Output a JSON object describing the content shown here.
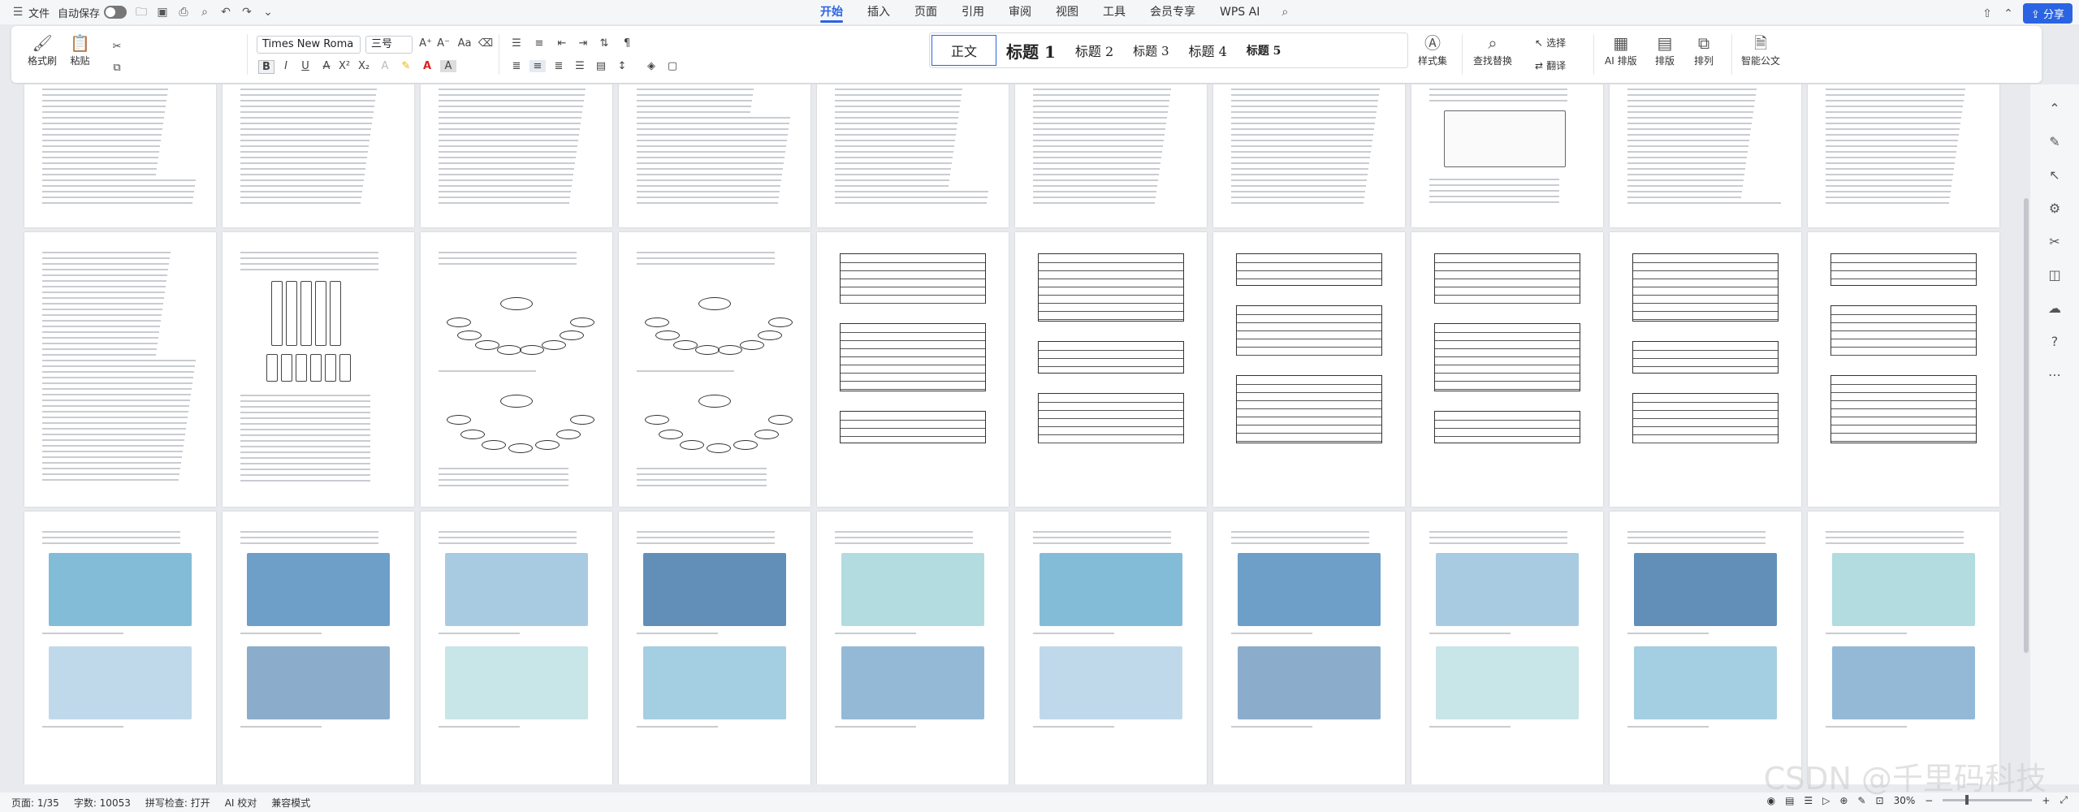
{
  "titlebar": {
    "file_label": "文件",
    "autosave_label": "自动保存",
    "tabs": [
      "开始",
      "插入",
      "页面",
      "引用",
      "审阅",
      "视图",
      "工具",
      "会员专享",
      "WPS AI"
    ],
    "share_label": "分享"
  },
  "ribbon": {
    "format_painter": "格式刷",
    "paste": "粘贴",
    "font_name": "Times New Roma",
    "font_size": "三号",
    "styles": [
      "正文",
      "标题 1",
      "标题 2",
      "标题 3",
      "标题 4",
      "标题 5"
    ],
    "style_set": "样式集",
    "find_replace": "查找替换",
    "select": "选择",
    "translate": "翻译",
    "ai_layout": "AI 排版",
    "layout": "排版",
    "arrange": "排列",
    "smart_doc": "智能公文"
  },
  "statusbar": {
    "page": "页面: 1/35",
    "words": "字数: 10053",
    "spellcheck": "拼写检查: 打开",
    "ai_check": "AI 校对",
    "compat": "兼容模式",
    "zoom": "30%"
  },
  "watermark": "CSDN @千里码科技",
  "icons": {
    "file": "file-icon",
    "undo": "undo-icon",
    "redo": "redo-icon",
    "search": "search-icon",
    "share": "share-icon",
    "bold": "bold-icon"
  }
}
